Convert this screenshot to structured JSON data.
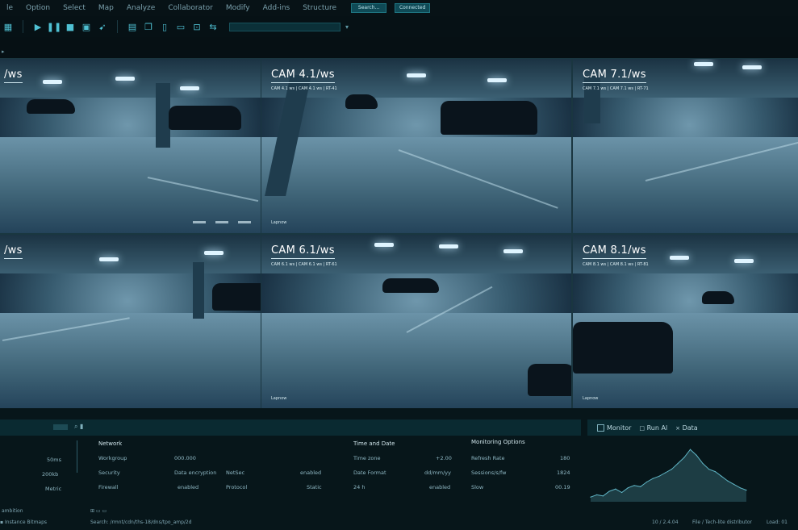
{
  "menu": {
    "items": [
      "le",
      "Option",
      "Select",
      "Map",
      "Analyze",
      "Collaborator",
      "Modify",
      "Add-ins",
      "Structure"
    ],
    "pill1": "Search...",
    "pill2": "Connected"
  },
  "cameras": [
    {
      "title": "/ws",
      "info": "",
      "foot": ""
    },
    {
      "title": "CAM 4.1/ws",
      "info": "CAM 4.1 ws | CAM 4.1 ws | RT-41",
      "foot": "Lapnow"
    },
    {
      "title": "CAM 7.1/ws",
      "info": "CAM 7.1 ws | CAM 7.1 ws | RT-71",
      "foot": ""
    },
    {
      "title": "/ws",
      "info": "",
      "foot": ""
    },
    {
      "title": "CAM 6.1/ws",
      "info": "CAM 6.1 ws | CAM 6.1 ws | RT-61",
      "foot": "Lapnow"
    },
    {
      "title": "CAM 8.1/ws",
      "info": "CAM 8.1 ws | CAM 8.1 ws | RT-81",
      "foot": "Lapnow"
    }
  ],
  "right_tabs": {
    "monitor": "Monitor",
    "run": "Run Al",
    "data": "Data"
  },
  "table": {
    "left_col": [
      "50ms",
      "200kb",
      "Metric"
    ],
    "network": {
      "header": "Network",
      "rows": [
        {
          "k": "Workgroup",
          "v": "000.000"
        },
        {
          "k": "Security",
          "v": "Data encryption"
        },
        {
          "k": "Firewall",
          "v": "enabled"
        }
      ]
    },
    "extra": {
      "rows": [
        {
          "k": "NetSec",
          "v": "enabled"
        },
        {
          "k": "Protocol",
          "v": "Static"
        }
      ]
    },
    "time": {
      "header": "Time and Date",
      "rows": [
        {
          "k": "Time zone",
          "v": "+2.00"
        },
        {
          "k": "Date Format",
          "v": "dd/mm/yy"
        },
        {
          "k": "24 h",
          "v": "enabled"
        }
      ]
    },
    "monitoring": {
      "header": "Monitoring Options",
      "rows": [
        {
          "k": "Refresh Rate",
          "v": "180"
        },
        {
          "k": "Sessions/s/fw",
          "v": "1824"
        },
        {
          "k": "Slow",
          "v": "00.19"
        }
      ]
    }
  },
  "status": {
    "left": "ambition",
    "item1": "Instance Bitmaps",
    "path": "Search: /rmnt/cdn/ths-18/dns/tpo_amp/2d",
    "right1": "10 / 2.4.04",
    "right2": "File / Tech-lite distributor",
    "right3": "Load: 01"
  },
  "chart_data": {
    "type": "area",
    "title": "",
    "xlabel": "",
    "ylabel": "",
    "x": [
      0,
      1,
      2,
      3,
      4,
      5,
      6,
      7,
      8,
      9,
      10,
      11,
      12,
      13,
      14,
      15,
      16,
      17,
      18,
      19,
      20,
      21,
      22,
      23,
      24,
      25
    ],
    "values": [
      4,
      6,
      5,
      9,
      11,
      8,
      12,
      14,
      13,
      17,
      20,
      22,
      25,
      28,
      33,
      38,
      45,
      40,
      33,
      28,
      26,
      22,
      18,
      15,
      12,
      10
    ],
    "ylim": [
      0,
      50
    ],
    "grid": false,
    "color": "#5fb4c4"
  }
}
